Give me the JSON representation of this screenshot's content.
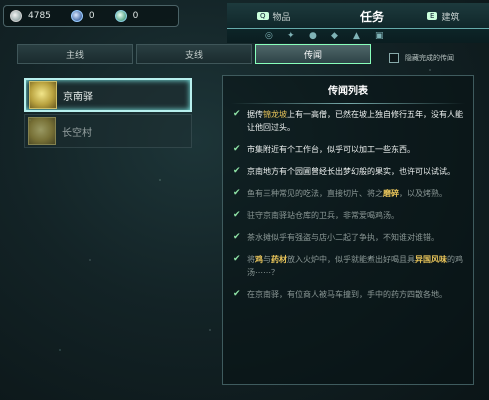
{
  "resources": [
    {
      "icon": "coin-icon",
      "value": "4785"
    },
    {
      "icon": "gem-icon",
      "value": "0"
    },
    {
      "icon": "leaf-icon",
      "value": "0"
    }
  ],
  "top_tabs": {
    "items_key": "Q",
    "items_label": "物品",
    "active_label": "任务",
    "build_key": "E",
    "build_label": "建筑"
  },
  "sub_tabs": [
    "主线",
    "支线",
    "传闻"
  ],
  "hide_completed_label": "隐藏完成的传闻",
  "quests": [
    {
      "name": "京南驿"
    },
    {
      "name": "长空村"
    }
  ],
  "panel": {
    "title": "传闻列表",
    "entries": [
      {
        "state": "active",
        "parts": [
          "据传",
          "锦龙坡",
          "上有一高僧，已然在坡上独自修行五年，没有人能让他回过头。"
        ]
      },
      {
        "state": "active",
        "parts": [
          "市集附近有个工作台，似乎可以加工一些东西。"
        ]
      },
      {
        "state": "active",
        "parts": [
          "京南地方有个园圃曾经长出梦幻般的果实，也许可以试试。"
        ]
      },
      {
        "state": "done",
        "parts": [
          "鱼有三种常见的吃法，直接切片、将之",
          "磨碎",
          "，以及烤熟。"
        ]
      },
      {
        "state": "done",
        "parts": [
          "驻守京南驿站仓库的卫兵，非常爱喝鸡汤。"
        ]
      },
      {
        "state": "done",
        "parts": [
          "茶水摊似乎有强盗与店小二起了争执，不知谁对谁错。"
        ]
      },
      {
        "state": "done",
        "parts": [
          "将",
          "鸡",
          "与",
          "药材",
          "放入火炉中，似乎就能煮出好喝且具",
          "异国风味",
          "的鸡汤⋯⋯？"
        ]
      },
      {
        "state": "done",
        "parts": [
          "在京南驿，有位商人被马车撞到，手中的药方四散各地。"
        ]
      }
    ]
  },
  "colors": {
    "accent": "#8fe3a6",
    "highlight": "#e8c45a",
    "selection": "#b8f0ee"
  }
}
